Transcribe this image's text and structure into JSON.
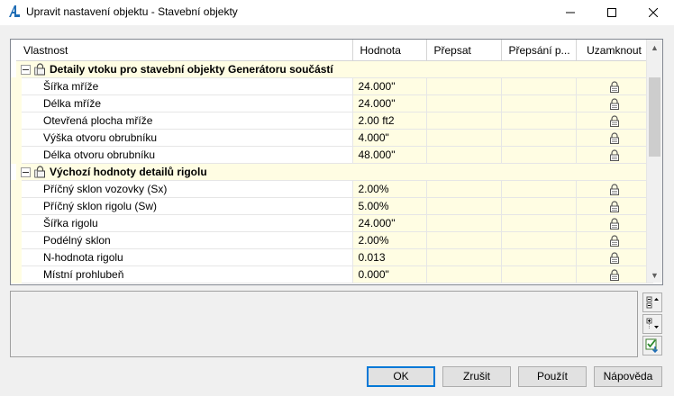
{
  "window": {
    "title": "Upravit nastavení objektu - Stavební objekty",
    "icon": "autocad-a-icon"
  },
  "grid": {
    "columns": [
      "Vlastnost",
      "Hodnota",
      "Přepsat",
      "Přepsání p...",
      "Uzamknout"
    ],
    "groups": [
      {
        "title": "Detaily vtoku pro stavební objekty Generátoru součástí",
        "rows": [
          {
            "name": "Šířka mříže",
            "value": "24.000\"",
            "locked": true
          },
          {
            "name": "Délka mříže",
            "value": "24.000\"",
            "locked": true
          },
          {
            "name": "Otevřená plocha mříže",
            "value": "2.00 ft2",
            "locked": true
          },
          {
            "name": "Výška otvoru obrubníku",
            "value": "4.000\"",
            "locked": true
          },
          {
            "name": "Délka otvoru obrubníku",
            "value": "48.000\"",
            "locked": true
          }
        ]
      },
      {
        "title": "Výchozí hodnoty detailů rigolu",
        "rows": [
          {
            "name": "Příčný sklon vozovky (Sx)",
            "value": "2.00%",
            "locked": true
          },
          {
            "name": "Příčný sklon rigolu (Sw)",
            "value": "5.00%",
            "locked": true
          },
          {
            "name": "Šířka rigolu",
            "value": "24.000\"",
            "locked": true
          },
          {
            "name": "Podélný sklon",
            "value": "2.00%",
            "locked": true
          },
          {
            "name": "N-hodnota rigolu",
            "value": "0.013",
            "locked": true
          },
          {
            "name": "Místní prohlubeň",
            "value": "0.000\"",
            "locked": true
          }
        ]
      }
    ]
  },
  "side_tools": [
    "expand-all-icon",
    "collapse-all-icon",
    "check-override-icon"
  ],
  "buttons": {
    "ok": "OK",
    "cancel": "Zrušit",
    "apply": "Použít",
    "help": "Nápověda"
  }
}
